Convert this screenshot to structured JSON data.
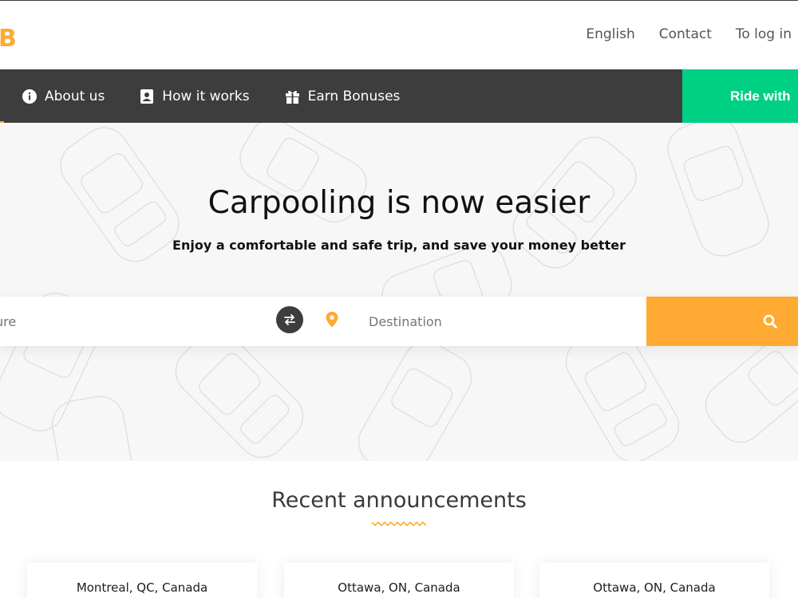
{
  "header": {
    "logo_fragment": "B",
    "links": [
      "English",
      "Contact",
      "To log in"
    ]
  },
  "nav": {
    "items": [
      {
        "label": "About us",
        "icon": "info-circle-icon"
      },
      {
        "label": "How it works",
        "icon": "id-card-icon"
      },
      {
        "label": "Earn Bonuses",
        "icon": "gift-icon"
      }
    ],
    "ride_button": "Ride with"
  },
  "hero": {
    "title": "Carpooling is now easier",
    "subtitle": "Enjoy a comfortable and safe trip, and save your money better"
  },
  "search": {
    "departure_placeholder": "ure",
    "destination_placeholder": "Destination",
    "swap_icon": "swap-arrows-icon",
    "pin_icon": "map-pin-icon",
    "search_icon": "search-icon"
  },
  "recent": {
    "title": "Recent announcements",
    "cards": [
      {
        "city": "Montreal, QC, Canada"
      },
      {
        "city": "Ottawa, ON, Canada"
      },
      {
        "city": "Ottawa, ON, Canada"
      }
    ]
  },
  "colors": {
    "accent": "#ffaa33",
    "green": "#00d084",
    "dark": "#3d3d3d"
  }
}
